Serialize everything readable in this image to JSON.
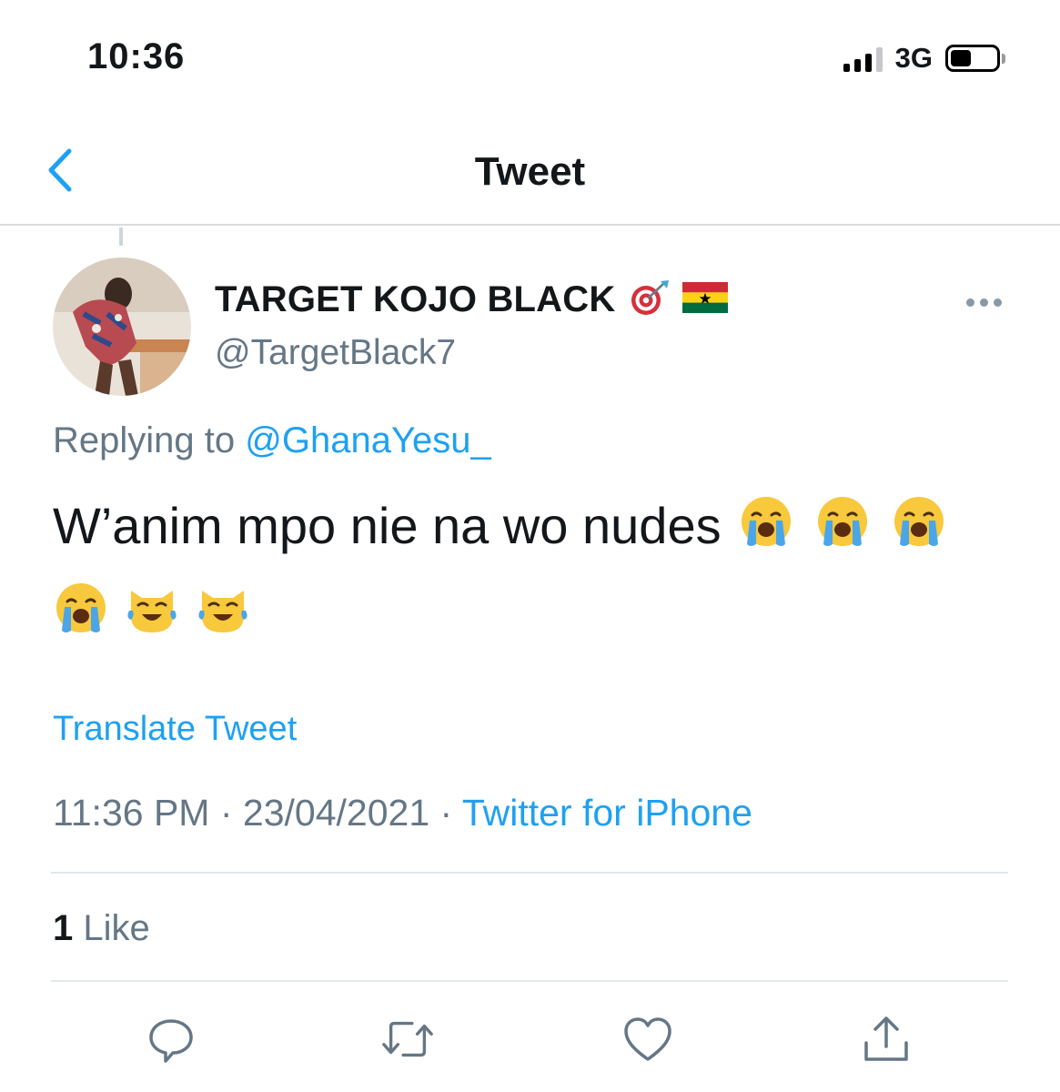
{
  "status_bar": {
    "time": "10:36",
    "network": "3G"
  },
  "nav": {
    "title": "Tweet"
  },
  "tweet": {
    "author_name": "TARGET KOJO BLACK",
    "author_handle": "@TargetBlack7",
    "replying_prefix": "Replying to",
    "replying_to": "@GhanaYesu_",
    "text": "W’anim mpo nie na wo nudes",
    "emojis": [
      "loudly-crying-face",
      "loudly-crying-face",
      "loudly-crying-face",
      "loudly-crying-face",
      "cat-tears-of-joy",
      "cat-tears-of-joy"
    ],
    "translate_label": "Translate Tweet",
    "time": "11:36 PM",
    "date": "23/04/2021",
    "separator": "·",
    "source": "Twitter for iPhone",
    "like_count": "1",
    "like_label": "Like"
  },
  "colors": {
    "accent": "#1da1f2",
    "muted": "#657786",
    "text": "#14171a",
    "divider": "#e1e8ed"
  },
  "icons": {
    "back": "chevron-left-icon",
    "more": "ellipsis-icon",
    "reply": "comment-icon",
    "retweet": "retweet-icon",
    "like": "heart-icon",
    "share": "share-icon"
  }
}
